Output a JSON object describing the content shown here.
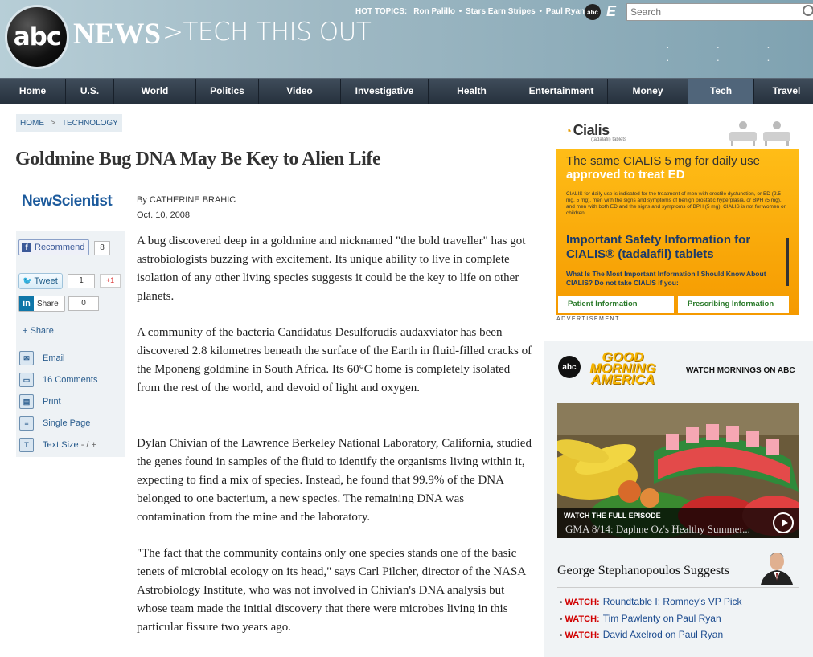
{
  "header": {
    "logo_text": "abc",
    "brand": "NEWS",
    "section": ">TECH THIS OUT",
    "hot_topics_label": "HOT TOPICS:",
    "hot_topics": [
      "Ron Palillo",
      "Stars Earn Stripes",
      "Paul Ryan"
    ],
    "mini_abc": "abc",
    "search_placeholder": "Search"
  },
  "nav": {
    "items": [
      "Home",
      "U.S.",
      "World",
      "Politics",
      "Video",
      "Investigative",
      "Health",
      "Entertainment",
      "Money",
      "Tech",
      "Travel"
    ],
    "active": "Tech"
  },
  "breadcrumb": {
    "home": "HOME",
    "sep": ">",
    "section": "TECHNOLOGY"
  },
  "article": {
    "headline": "Goldmine Bug DNA May Be Key to Alien Life",
    "source_logo": "NewScientist",
    "byline": "By CATHERINE BRAHIC",
    "date": "Oct. 10, 2008",
    "paragraphs": [
      "A bug discovered deep in a goldmine and nicknamed \"the bold traveller\" has got astrobiologists buzzing with excitement. Its unique ability to live in complete isolation of any other living species suggests it could be the key to life on other planets.",
      "A community of the bacteria Candidatus Desulforudis audaxviator has been discovered 2.8 kilometres beneath the surface of the Earth in fluid-filled cracks of the Mponeng goldmine in South Africa. Its 60°C home is completely isolated from the rest of the world, and devoid of light and oxygen.",
      "Dylan Chivian of the Lawrence Berkeley National Laboratory, California, studied the genes found in samples of the fluid to identify the organisms living within it, expecting to find a mix of species. Instead, he found that 99.9% of the DNA belonged to one bacterium, a new species. The remaining DNA was contamination from the mine and the laboratory.",
      "\"The fact that the community contains only one species stands one of the basic tenets of microbial ecology on its head,\" says Carl Pilcher, director of the NASA Astrobiology Institute, who was not involved in Chivian's DNA analysis but whose team made the initial discovery that there were microbes living in this particular fissure two years ago."
    ]
  },
  "social": {
    "fb_label": "Recommend",
    "fb_count": "8",
    "tweet_label": "Tweet",
    "tweet_count": "1",
    "gplus_label": "+1",
    "li_label": "Share",
    "li_count": "0",
    "share_label": "+ Share",
    "tools": [
      "Email",
      "16 Comments",
      "Print",
      "Single Page",
      "Text Size"
    ],
    "text_size_controls": "- / +"
  },
  "ad": {
    "brand": "Cialis",
    "brand_sub": "(tadalafil) tablets",
    "headline1": "The same CIALIS 5 mg for daily use",
    "headline2": "approved to treat ED",
    "small_print": "CIALIS for daily use is indicated for the treatment of men with erectile dysfunction, or ED (2.5 mg, 5 mg), men with the signs and symptoms of benign prostatic hyperplasia, or BPH (5 mg), and men with both ED and the signs and symptoms of BPH (5 mg). CIALIS is not for women or children.",
    "important": "Important Safety Information for CIALIS® (tadalafil) tablets",
    "question": "What Is The Most Important Information I Should Know About CIALIS? Do not take CIALIS if you:",
    "tab_patient": "Patient Information",
    "tab_prescribing": "Prescribing Information",
    "label": "ADVERTISEMENT"
  },
  "gma": {
    "abc": "abc",
    "logo": "GOOD MORNING AMERICA",
    "watch": "WATCH MORNINGS ON ABC",
    "full_episode": "WATCH THE FULL EPISODE",
    "caption": "GMA 8/14: Daphne Oz's Healthy Summer...",
    "suggests_title": "George Stephanopoulos Suggests",
    "suggestions": [
      {
        "watch": "WATCH:",
        "text": "Roundtable I: Romney's VP Pick"
      },
      {
        "watch": "WATCH:",
        "text": "Tim Pawlenty on Paul Ryan"
      },
      {
        "watch": "WATCH:",
        "text": "David Axelrod on Paul Ryan"
      }
    ]
  },
  "colors": {
    "nav_bg": "#2b3643",
    "nav_active": "#50657a",
    "link": "#2a5d8e",
    "ad_orange": "#f7a400",
    "watch_red": "#d10000"
  }
}
